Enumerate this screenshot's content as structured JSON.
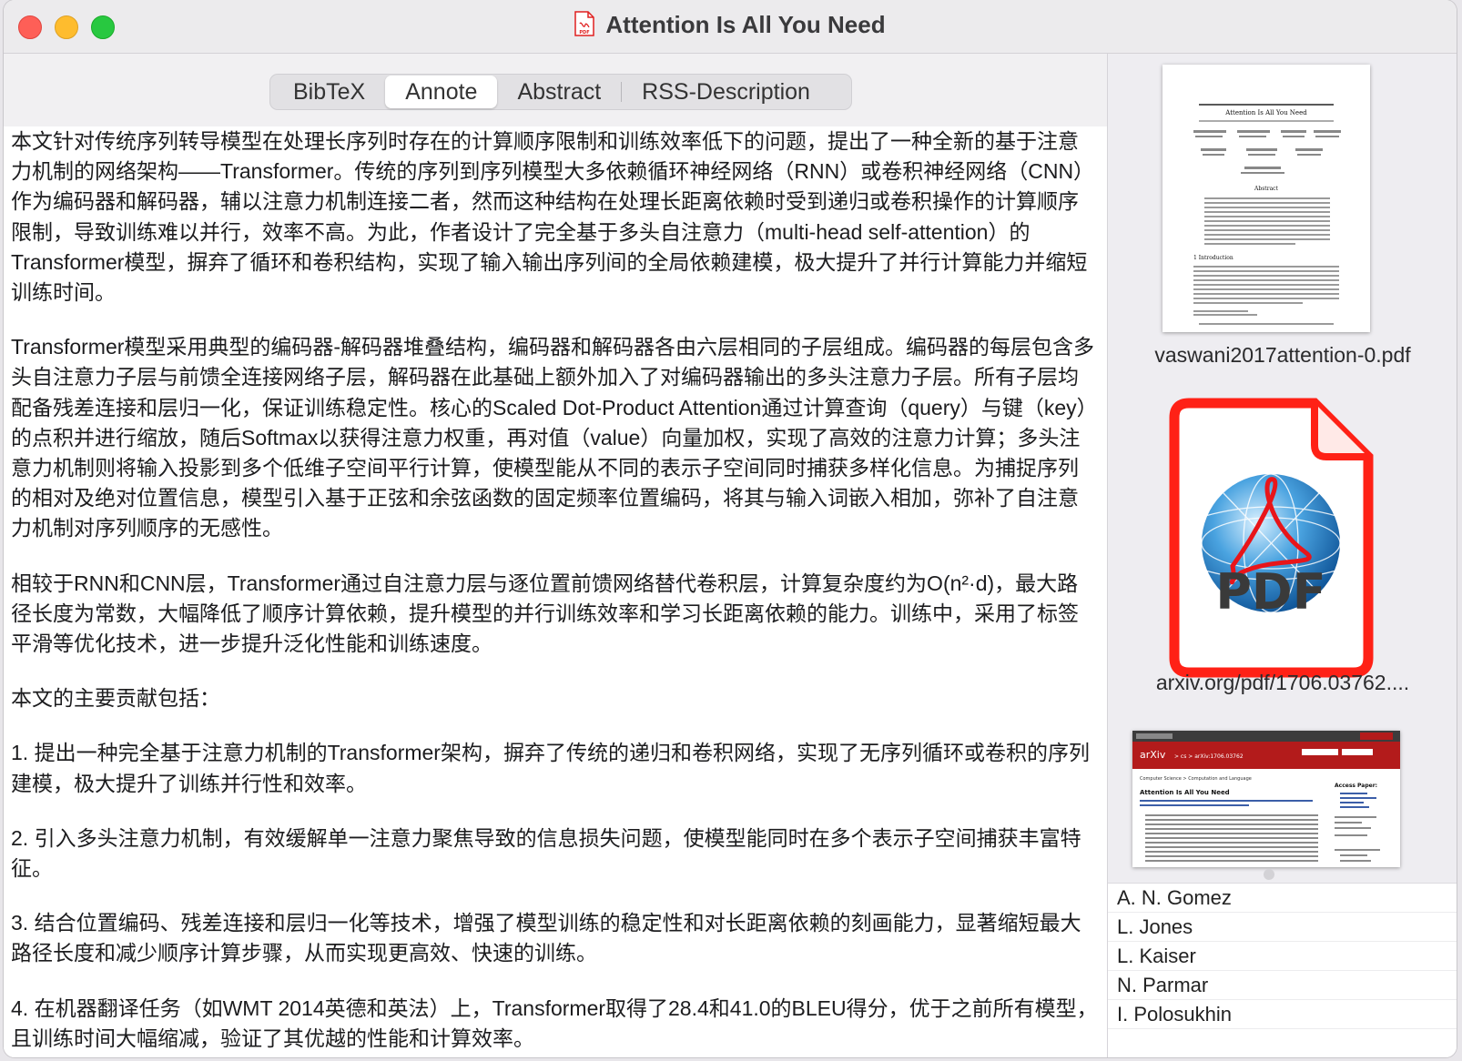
{
  "window": {
    "title": "Attention Is All You Need"
  },
  "tabs": [
    {
      "label": "BibTeX"
    },
    {
      "label": "Annote"
    },
    {
      "label": "Abstract"
    },
    {
      "label": "RSS-Description"
    }
  ],
  "annote": {
    "paragraphs": [
      "本文针对传统序列转导模型在处理长序列时存在的计算顺序限制和训练效率低下的问题，提出了一种全新的基于注意力机制的网络架构——Transformer。传统的序列到序列模型大多依赖循环神经网络（RNN）或卷积神经网络（CNN）作为编码器和解码器，辅以注意力机制连接二者，然而这种结构在处理长距离依赖时受到递归或卷积操作的计算顺序限制，导致训练难以并行，效率不高。为此，作者设计了完全基于多头自注意力（multi-head self-attention）的Transformer模型，摒弃了循环和卷积结构，实现了输入输出序列间的全局依赖建模，极大提升了并行计算能力并缩短训练时间。",
      "Transformer模型采用典型的编码器-解码器堆叠结构，编码器和解码器各由六层相同的子层组成。编码器的每层包含多头自注意力子层与前馈全连接网络子层，解码器在此基础上额外加入了对编码器输出的多头注意力子层。所有子层均配备残差连接和层归一化，保证训练稳定性。核心的Scaled Dot-Product Attention通过计算查询（query）与键（key）的点积并进行缩放，随后Softmax以获得注意力权重，再对值（value）向量加权，实现了高效的注意力计算；多头注意力机制则将输入投影到多个低维子空间平行计算，使模型能从不同的表示子空间同时捕获多样化信息。为捕捉序列的相对及绝对位置信息，模型引入基于正弦和余弦函数的固定频率位置编码，将其与输入词嵌入相加，弥补了自注意力机制对序列顺序的无感性。",
      "相较于RNN和CNN层，Transformer通过自注意力层与逐位置前馈网络替代卷积层，计算复杂度约为O(n²·d)，最大路径长度为常数，大幅降低了顺序计算依赖，提升模型的并行训练效率和学习长距离依赖的能力。训练中，采用了标签平滑等优化技术，进一步提升泛化性能和训练速度。",
      "本文的主要贡献包括：",
      "1. 提出一种完全基于注意力机制的Transformer架构，摒弃了传统的递归和卷积网络，实现了无序列循环或卷积的序列建模，极大提升了训练并行性和效率。",
      "2. 引入多头注意力机制，有效缓解单一注意力聚焦导致的信息损失问题，使模型能同时在多个表示子空间捕获丰富特征。",
      "3. 结合位置编码、残差连接和层归一化等技术，增强了模型训练的稳定性和对长距离依赖的刻画能力，显著缩短最大路径长度和减少顺序计算步骤，从而实现更高效、快速的训练。",
      "4. 在机器翻译任务（如WMT 2014英德和英法）上，Transformer取得了28.4和41.0的BLEU得分，优于之前所有模型，且训练时间大幅缩减，验证了其优越的性能和计算效率。"
    ]
  },
  "files": [
    {
      "label": "vaswani2017attention-0.pdf"
    },
    {
      "label": "arxiv.org/pdf/1706.03762...."
    }
  ],
  "thumb_pdf": {
    "title": "Attention Is All You Need",
    "abstract_heading": "Abstract",
    "intro_heading": "1   Introduction"
  },
  "pdf_icon": {
    "text": "PDF"
  },
  "thumb_web": {
    "brand": "arXiv",
    "breadcrumb": "> cs > arXiv:1706.03762",
    "paper_title": "Attention Is All You Need",
    "section": "Computer Science > Computation and Language",
    "access": "Access Paper:"
  },
  "authors": [
    "A. N. Gomez",
    "L. Jones",
    "L. Kaiser",
    "N. Parmar",
    "I. Polosukhin"
  ],
  "colors": {
    "accent_red": "#ff2116",
    "arxiv_red": "#b31b1b",
    "active_tab_bg": "#ffffff"
  }
}
